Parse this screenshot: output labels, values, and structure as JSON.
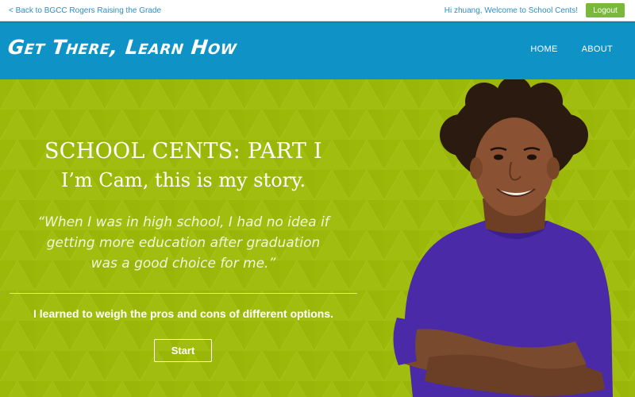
{
  "topbar": {
    "back_link": "< Back to BGCC Rogers Raising the Grade",
    "welcome": "Hi zhuang, Welcome to School Cents!",
    "logout_label": "Logout"
  },
  "header": {
    "brand": "Get There, Learn How",
    "nav": [
      {
        "label": "HOME"
      },
      {
        "label": "ABOUT"
      }
    ]
  },
  "hero": {
    "title": "SCHOOL CENTS: PART I",
    "subtitle": "I’m Cam, this is my story.",
    "quote_lines": [
      "“When I was in high school, I had no idea if",
      "getting more education after graduation",
      "was a good choice for me.”"
    ],
    "lesson": "I learned to weigh the pros and cons of different options.",
    "start_label": "Start"
  },
  "colors": {
    "header_blue": "#0f92c6",
    "hero_green": "#9cb90a",
    "logout_green": "#7ab83a",
    "link_blue": "#2a8fc9",
    "shirt_purple": "#4a2aa6"
  }
}
